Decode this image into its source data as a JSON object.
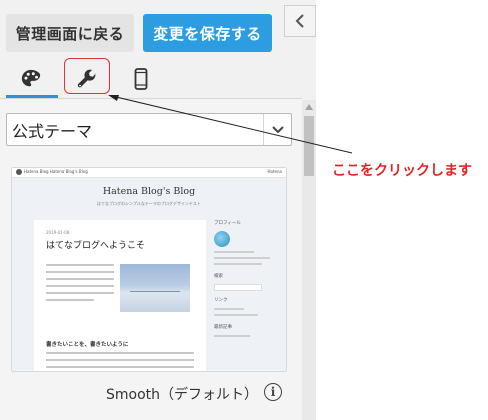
{
  "header": {
    "back_label": "管理画面に戻る",
    "save_label": "変更を保存する"
  },
  "tabs": [
    {
      "name": "design",
      "icon": "palette-icon",
      "active": true
    },
    {
      "name": "customize",
      "icon": "wrench-icon",
      "active": false
    },
    {
      "name": "smartphone",
      "icon": "smartphone-icon",
      "active": false
    }
  ],
  "theme_select": {
    "value": "公式テーマ"
  },
  "theme_preview": {
    "blog_title": "Hatena Blog's Blog",
    "blog_description": "はてなブログのシンプルなテーマのブログデザインテスト",
    "bar_left": "Hatena Blog  Hatena Blog's Blog",
    "bar_right": "Hatena",
    "post_date": "2019-01-08",
    "post_title": "はてなブログへようこそ",
    "section_heading": "書きたいことを、書きたいように",
    "sidebar_profile": "プロフィール",
    "sidebar_search": "検索",
    "sidebar_links": "リンク",
    "sidebar_recent": "最新記事"
  },
  "theme_name": "Smooth（デフォルト）",
  "annotation": {
    "text": "ここをクリックします",
    "color": "#e02424"
  },
  "colors": {
    "save_button": "#2b9de0",
    "tab_underline": "#3a8bd6"
  }
}
